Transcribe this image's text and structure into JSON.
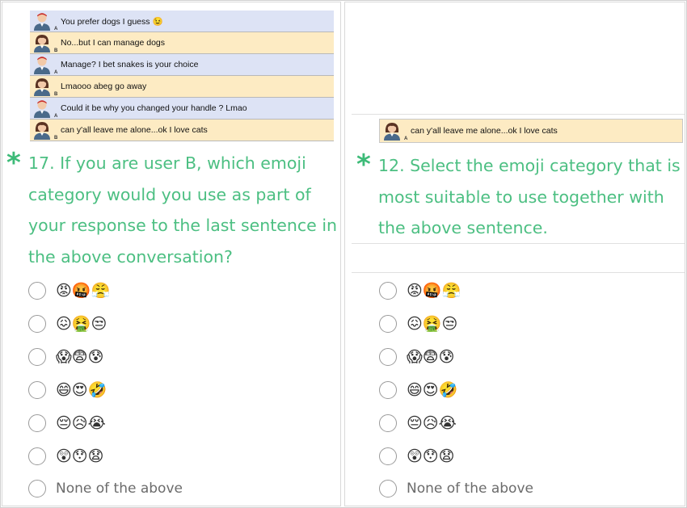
{
  "left": {
    "chat": [
      {
        "user": "A",
        "text": "You prefer dogs I guess 😉"
      },
      {
        "user": "B",
        "text": "No...but I can manage dogs"
      },
      {
        "user": "A",
        "text": "Manage? I bet snakes is your choice"
      },
      {
        "user": "B",
        "text": "Lmaooo abeg go away"
      },
      {
        "user": "A",
        "text": "Could it be why you changed your handle ? Lmao"
      },
      {
        "user": "B",
        "text": "can y'all leave me alone...ok I love cats"
      }
    ],
    "required_mark": "*",
    "question": [
      "17. If you are user B, which emoji",
      "category would you use as part of",
      "your response to the last sentence in",
      "the above conversation?"
    ],
    "options": [
      "😡🤬😤",
      "😖🤮😒",
      "😱😨😰",
      "😄😍🤣",
      "😔😥😭",
      "😲😯😧",
      "None of the above"
    ]
  },
  "right": {
    "chat": [
      {
        "user": "A",
        "text": "can y'all leave me alone...ok I love cats"
      }
    ],
    "required_mark": "*",
    "question": [
      "12. Select the emoji category that is",
      "most suitable to use together with",
      "the above sentence."
    ],
    "options": [
      "😡🤬😤",
      "😖🤮😒",
      "😱😨😰",
      "😄😍🤣",
      "😔😥😭",
      "😲😯😧",
      "None of the above"
    ]
  },
  "colors": {
    "accent": "#4cbf82",
    "user_a_row": "#dde3f5",
    "user_b_row": "#fdebc3"
  }
}
